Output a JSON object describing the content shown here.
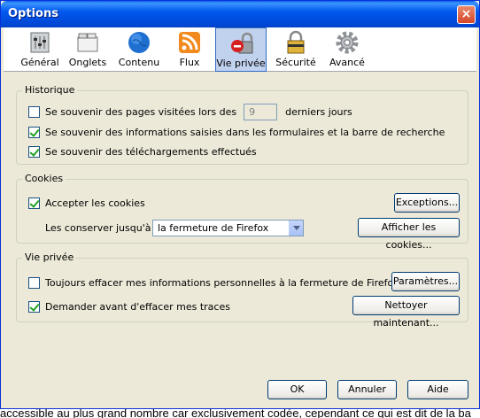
{
  "window": {
    "title": "Options",
    "close_label": "×"
  },
  "panes": [
    {
      "label": "Général",
      "icon": "general-settings-icon"
    },
    {
      "label": "Onglets",
      "icon": "tabs-icon"
    },
    {
      "label": "Contenu",
      "icon": "globe-icon"
    },
    {
      "label": "Flux",
      "icon": "rss-feed-icon"
    },
    {
      "label": "Vie privée",
      "icon": "privacy-lock-icon",
      "selected": true
    },
    {
      "label": "Sécurité",
      "icon": "padlock-icon"
    },
    {
      "label": "Avancé",
      "icon": "gear-icon"
    }
  ],
  "history": {
    "title": "Historique",
    "remember_pages_label": "Se souvenir des pages visitées lors des",
    "remember_pages_checked": false,
    "days_value": "9",
    "days_suffix": "derniers jours",
    "remember_forms_label": "Se souvenir des informations saisies dans les formulaires et la barre de recherche",
    "remember_forms_checked": true,
    "remember_downloads_label": "Se souvenir des téléchargements effectués",
    "remember_downloads_checked": true
  },
  "cookies": {
    "title": "Cookies",
    "accept_label": "Accepter les cookies",
    "accept_checked": true,
    "exceptions_button": "Exceptions...",
    "keep_until_label": "Les conserver jusqu'à :",
    "keep_until_value": "la fermeture de Firefox",
    "show_cookies_button": "Afficher les cookies..."
  },
  "private_data": {
    "title": "Vie privée",
    "always_clear_label": "Toujours effacer mes informations personnelles à la fermeture de Firefox",
    "always_clear_checked": false,
    "settings_button": "Paramètres...",
    "ask_before_label": "Demander avant d'effacer mes traces",
    "ask_before_checked": true,
    "clear_now_button": "Nettoyer maintenant..."
  },
  "dialog_buttons": {
    "ok": "OK",
    "cancel": "Annuler",
    "help": "Aide"
  },
  "background_text": "accessible au plus grand nombre car exclusivement codée, cependant ce qui est dit de la ba"
}
